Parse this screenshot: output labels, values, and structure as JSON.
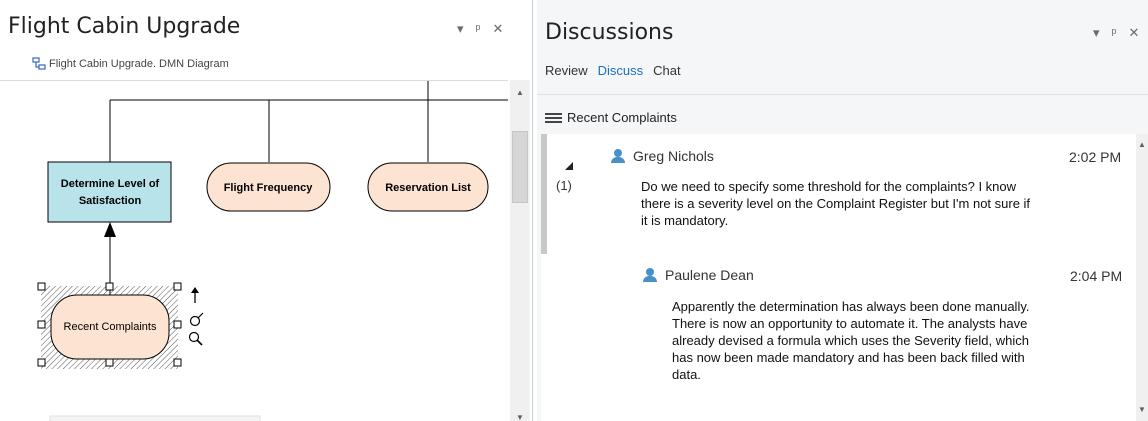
{
  "left_panel": {
    "title": "Flight Cabin Upgrade",
    "controls": [
      "▾",
      "ᵖ",
      "✕"
    ],
    "diagram_label": "Flight Cabin Upgrade.  DMN Diagram",
    "nodes": {
      "decision": [
        "Determine Level of",
        "Satisfaction"
      ],
      "flight_frequency": "Flight Frequency",
      "reservation_list": "Reservation List",
      "recent_complaints": "Recent Complaints"
    }
  },
  "right_panel": {
    "title": "Discussions",
    "controls": [
      "▾",
      "ᵖ",
      "✕"
    ],
    "tabs": [
      "Review",
      "Discuss",
      "Chat"
    ],
    "active_tab": "Discuss",
    "section_title": "Recent Complaints",
    "messages": [
      {
        "author": "Greg Nichols",
        "time": "2:02 PM",
        "count": "(1)",
        "lines": [
          "Do we need to specify some threshold for the complaints?  I know",
          "there is a severity level on the Complaint Register but I'm not sure if",
          "it is mandatory."
        ]
      },
      {
        "author": "Paulene Dean",
        "time": "2:04 PM",
        "lines": [
          "Apparently the determination has always been done manually.",
          "There is now an opportunity to automate it. The analysts have",
          "already devised a formula which uses the Severity field, which",
          "has now been made mandatory and has been back filled with",
          "data."
        ]
      }
    ]
  },
  "colors": {
    "decision_fill": "#b8e3ea",
    "input_fill": "#fde3d2",
    "accent": "#1b6fbf",
    "avatar": "#4a90c8"
  }
}
